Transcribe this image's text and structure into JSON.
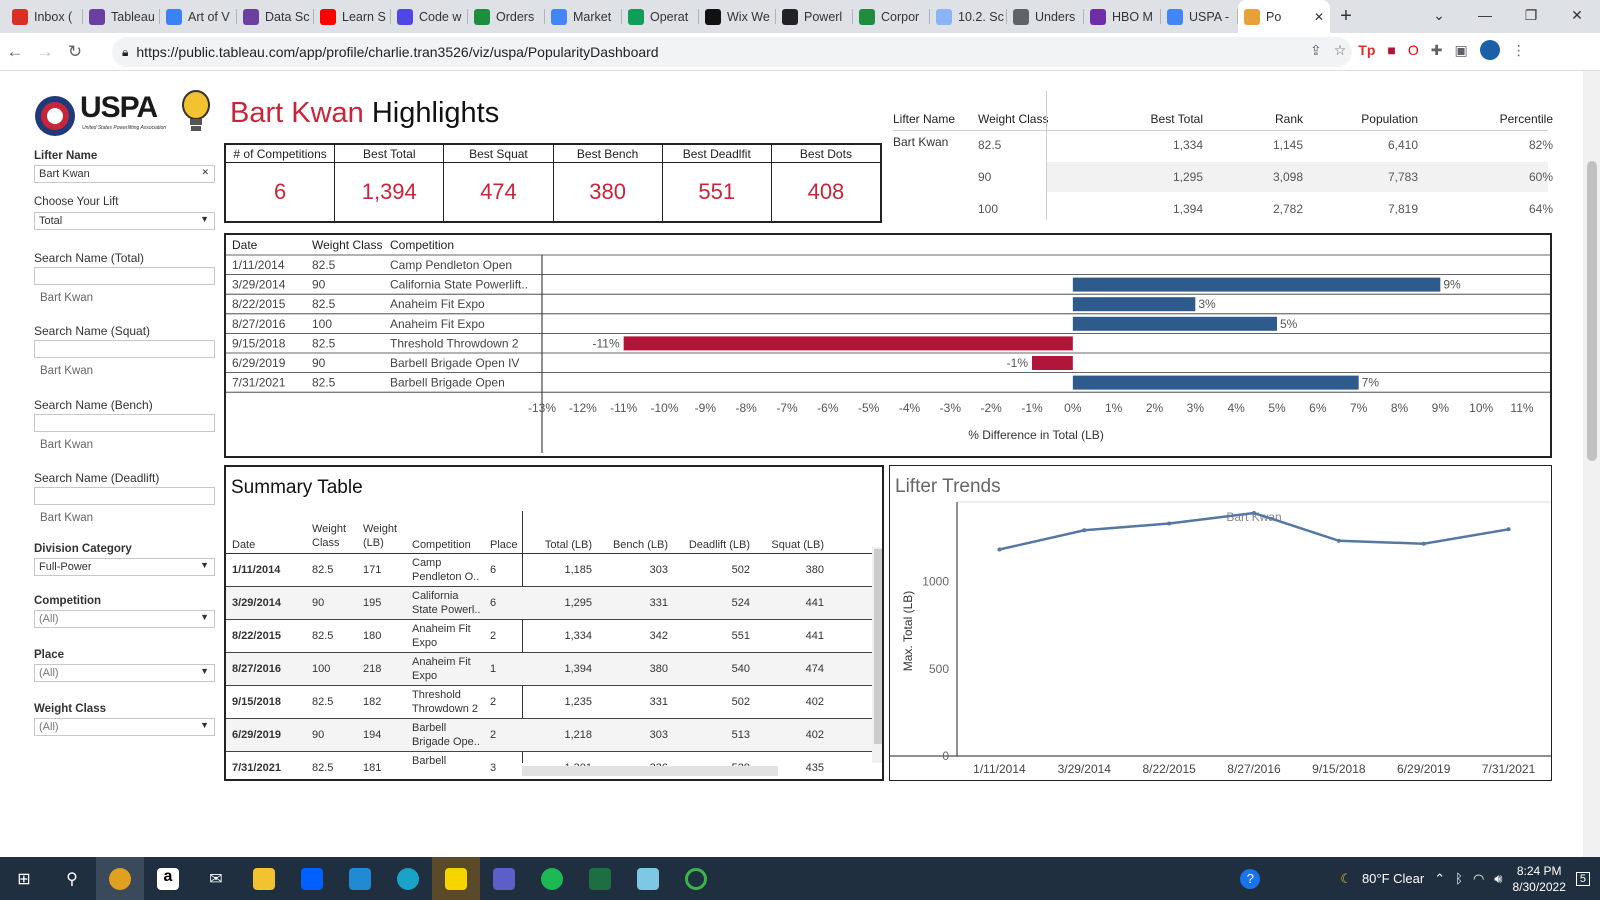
{
  "browser": {
    "tabs": [
      {
        "label": "Inbox (",
        "icon": "gmail-icon",
        "color": "#d93025"
      },
      {
        "label": "Tableau",
        "icon": "tableau-icon",
        "color": "#6b3fa0"
      },
      {
        "label": "Art of V",
        "icon": "chart-icon",
        "color": "#3b82f6"
      },
      {
        "label": "Data Sc",
        "icon": "tableau-icon",
        "color": "#6b3fa0"
      },
      {
        "label": "Learn S",
        "icon": "youtube-icon",
        "color": "#ff0000"
      },
      {
        "label": "Code w",
        "icon": "code-icon",
        "color": "#4f46e5"
      },
      {
        "label": "Orders",
        "icon": "drive-icon",
        "color": "#1e8e3e"
      },
      {
        "label": "Market",
        "icon": "docs-icon",
        "color": "#4285f4"
      },
      {
        "label": "Operat",
        "icon": "sheets-icon",
        "color": "#0f9d58"
      },
      {
        "label": "Wix We",
        "icon": "wix-icon",
        "color": "#111111"
      },
      {
        "label": "Powerl",
        "icon": "pl-icon",
        "color": "#222222"
      },
      {
        "label": "Corpor",
        "icon": "drive-icon",
        "color": "#1e8e3e"
      },
      {
        "label": "10.2. Sc",
        "icon": "globe-icon",
        "color": "#8ab4f8"
      },
      {
        "label": "Unders",
        "icon": "globe-icon",
        "color": "#5f6368"
      },
      {
        "label": "HBO M",
        "icon": "hbo-icon",
        "color": "#6f2da8"
      },
      {
        "label": "USPA -",
        "icon": "docs-icon",
        "color": "#4285f4"
      },
      {
        "label": "Po",
        "icon": "tableau-icon",
        "color": "#e8a13a",
        "active": true
      }
    ],
    "url": "https://public.tableau.com/app/profile/charlie.tran3526/viz/uspa/PopularityDashboard"
  },
  "dashboard": {
    "logo": "USPA",
    "logo_sub": "United States Powerlifting Association",
    "title_name": "Bart Kwan",
    "title_rest": " Highlights",
    "filters": {
      "lifter_name_label": "Lifter Name",
      "lifter_name_value": "Bart Kwan",
      "choose_lift_label": "Choose Your Lift",
      "choose_lift_value": "Total",
      "search_total_label": "Search Name (Total)",
      "search_total_result": "Bart Kwan",
      "search_squat_label": "Search Name (Squat)",
      "search_squat_result": "Bart Kwan",
      "search_bench_label": "Search Name (Bench)",
      "search_bench_result": "Bart Kwan",
      "search_deadlift_label": "Search Name (Deadlift)",
      "search_deadlift_result": "Bart Kwan",
      "division_label": "Division Category",
      "division_value": "Full-Power",
      "competition_label": "Competition",
      "competition_value": "(All)",
      "place_label": "Place",
      "place_value": "(All)",
      "weight_class_label": "Weight Class",
      "weight_class_value": "(All)"
    },
    "kpis": [
      {
        "label": "# of Competitions",
        "value": "6"
      },
      {
        "label": "Best Total",
        "value": "1,394"
      },
      {
        "label": "Best Squat",
        "value": "474"
      },
      {
        "label": "Best Bench",
        "value": "380"
      },
      {
        "label": "Best Deadlfit",
        "value": "551"
      },
      {
        "label": "Best Dots",
        "value": "408"
      }
    ],
    "rank_table": {
      "headers": [
        "Lifter Name",
        "Weight Class",
        "Best Total",
        "Rank",
        "Population",
        "Percentile"
      ],
      "lifter": "Bart Kwan",
      "rows": [
        {
          "weight_class": "82.5",
          "best_total": "1,334",
          "rank": "1,145",
          "population": "6,410",
          "percentile": "82%"
        },
        {
          "weight_class": "90",
          "best_total": "1,295",
          "rank": "3,098",
          "population": "7,783",
          "percentile": "60%"
        },
        {
          "weight_class": "100",
          "best_total": "1,394",
          "rank": "2,782",
          "population": "7,819",
          "percentile": "64%"
        }
      ]
    },
    "bar_table": {
      "headers": [
        "Date",
        "Weight Class",
        "Competition"
      ],
      "rows": [
        {
          "date": "1/11/2014",
          "wc": "82.5",
          "comp": "Camp Pendleton Open"
        },
        {
          "date": "3/29/2014",
          "wc": "90",
          "comp": "California State Powerlift.."
        },
        {
          "date": "8/22/2015",
          "wc": "82.5",
          "comp": "Anaheim Fit Expo"
        },
        {
          "date": "8/27/2016",
          "wc": "100",
          "comp": "Anaheim Fit Expo"
        },
        {
          "date": "9/15/2018",
          "wc": "82.5",
          "comp": "Threshold Throwdown 2"
        },
        {
          "date": "6/29/2019",
          "wc": "90",
          "comp": "Barbell Brigade Open IV"
        },
        {
          "date": "7/31/2021",
          "wc": "82.5",
          "comp": "Barbell Brigade Open"
        }
      ],
      "axis_title": "% Difference in Total (LB)"
    },
    "summary": {
      "title": "Summary Table",
      "headers": {
        "date": "Date",
        "wclass_1": "Weight",
        "wclass_2": "Class",
        "wlb_1": "Weight",
        "wlb_2": "(LB)",
        "comp": "Competition",
        "place": "Place",
        "total": "Total (LB)",
        "bench": "Bench (LB)",
        "dead": "Deadlift (LB)",
        "squat": "Squat (LB)"
      },
      "rows": [
        {
          "date": "1/11/2014",
          "wc": "82.5",
          "wlb": "171",
          "comp1": "Camp",
          "comp2": "Pendleton O..",
          "place": "6",
          "total": "1,185",
          "bench": "303",
          "dead": "502",
          "squat": "380"
        },
        {
          "date": "3/29/2014",
          "wc": "90",
          "wlb": "195",
          "comp1": "California",
          "comp2": "State Powerl..",
          "place": "6",
          "total": "1,295",
          "bench": "331",
          "dead": "524",
          "squat": "441"
        },
        {
          "date": "8/22/2015",
          "wc": "82.5",
          "wlb": "180",
          "comp1": "Anaheim Fit",
          "comp2": "Expo",
          "place": "2",
          "total": "1,334",
          "bench": "342",
          "dead": "551",
          "squat": "441"
        },
        {
          "date": "8/27/2016",
          "wc": "100",
          "wlb": "218",
          "comp1": "Anaheim Fit",
          "comp2": "Expo",
          "place": "1",
          "total": "1,394",
          "bench": "380",
          "dead": "540",
          "squat": "474"
        },
        {
          "date": "9/15/2018",
          "wc": "82.5",
          "wlb": "182",
          "comp1": "Threshold",
          "comp2": "Throwdown 2",
          "place": "2",
          "total": "1,235",
          "bench": "331",
          "dead": "502",
          "squat": "402"
        },
        {
          "date": "6/29/2019",
          "wc": "90",
          "wlb": "194",
          "comp1": "Barbell",
          "comp2": "Brigade Ope..",
          "place": "2",
          "total": "1,218",
          "bench": "303",
          "dead": "513",
          "squat": "402"
        },
        {
          "date": "7/31/2021",
          "wc": "82.5",
          "wlb": "181",
          "comp1": "Barbell",
          "comp2": "",
          "place": "3",
          "total": "1,301",
          "bench": "336",
          "dead": "529",
          "squat": "435"
        }
      ]
    },
    "trends": {
      "title": "Lifter Trends",
      "panel_label": "Bart Kwan",
      "ylabel": "Max. Total (LB)"
    }
  },
  "chart_data": [
    {
      "type": "bar",
      "xlabel": "% Difference in Total (LB)",
      "categories": [
        "1/11/2014",
        "3/29/2014",
        "8/22/2015",
        "8/27/2016",
        "9/15/2018",
        "6/29/2019",
        "7/31/2021"
      ],
      "values": [
        null,
        9,
        3,
        5,
        -11,
        -1,
        7
      ],
      "labels": [
        "",
        "9%",
        "3%",
        "5%",
        "-11%",
        "-1%",
        "7%"
      ],
      "xticks": [
        "-13%",
        "-12%",
        "-11%",
        "-10%",
        "-9%",
        "-8%",
        "-7%",
        "-6%",
        "-5%",
        "-4%",
        "-3%",
        "-2%",
        "-1%",
        "0%",
        "1%",
        "2%",
        "3%",
        "4%",
        "5%",
        "6%",
        "7%",
        "8%",
        "9%",
        "10%",
        "11%"
      ],
      "xlim": [
        -13,
        11
      ],
      "colors": {
        "positive": "#2f5b8c",
        "negative": "#b1163a"
      }
    },
    {
      "type": "line",
      "title": "Lifter Trends",
      "ylabel": "Max. Total (LB)",
      "categories": [
        "1/11/2014",
        "3/29/2014",
        "8/22/2015",
        "8/27/2016",
        "9/15/2018",
        "6/29/2019",
        "7/31/2021"
      ],
      "values": [
        1185,
        1295,
        1334,
        1394,
        1235,
        1218,
        1301
      ],
      "yticks": [
        "0",
        "500",
        "1000"
      ],
      "ylim": [
        0,
        1400
      ],
      "color": "#5577a3"
    }
  ],
  "taskbar": {
    "weather": "80°F  Clear",
    "time": "8:24 PM",
    "date": "8/30/2022",
    "notif": "5"
  }
}
